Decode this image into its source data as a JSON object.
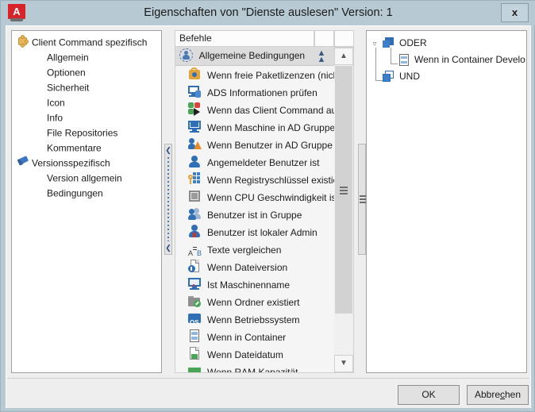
{
  "window": {
    "title": "Eigenschaften von \"Dienste auslesen\" Version: 1",
    "app_icon": "app-logo-a-icon",
    "app_icon_letter": "A",
    "close_label": "x"
  },
  "left_tree": {
    "items": [
      {
        "label": "Client Command spezifisch",
        "icon": "puzzle-icon",
        "indent": 0
      },
      {
        "label": "Allgemein",
        "icon": "none",
        "indent": 1
      },
      {
        "label": "Optionen",
        "icon": "none",
        "indent": 1
      },
      {
        "label": "Sicherheit",
        "icon": "none",
        "indent": 1
      },
      {
        "label": "Icon",
        "icon": "none",
        "indent": 1
      },
      {
        "label": "Info",
        "icon": "none",
        "indent": 1
      },
      {
        "label": "File Repositories",
        "icon": "none",
        "indent": 1
      },
      {
        "label": "Kommentare",
        "icon": "none",
        "indent": 1
      },
      {
        "label": "Versionsspezifisch",
        "icon": "pushpin-icon",
        "indent": 0
      },
      {
        "label": "Version allgemein",
        "icon": "none",
        "indent": 1
      },
      {
        "label": "Bedingungen",
        "icon": "none",
        "indent": 1
      }
    ]
  },
  "command_list": {
    "columns": [
      "Befehle",
      "",
      ""
    ],
    "group": {
      "label": "Allgemeine Bedingungen",
      "icon": "group-condition-icon",
      "collapse_icon": "chevron-double-up-icon"
    },
    "items": [
      {
        "label": "Wenn freie Paketlizenzen (nich...",
        "icon": "license-lock-icon"
      },
      {
        "label": "ADS Informationen prüfen",
        "icon": "ads-monitor-icon"
      },
      {
        "label": "Wenn das Client Command aus...",
        "icon": "command-run-icon"
      },
      {
        "label": "Wenn Maschine in AD Gruppe ist",
        "icon": "ad-machine-icon"
      },
      {
        "label": "Wenn Benutzer in AD Gruppe ist",
        "icon": "ad-user-icon"
      },
      {
        "label": "Angemeldeter Benutzer ist",
        "icon": "user-icon"
      },
      {
        "label": "Wenn Registryschlüssel existiert",
        "icon": "registry-key-icon"
      },
      {
        "label": "Wenn CPU Geschwindigkeit ist",
        "icon": "cpu-icon"
      },
      {
        "label": "Benutzer ist in Gruppe",
        "icon": "user-group-icon"
      },
      {
        "label": "Benutzer ist lokaler Admin",
        "icon": "user-admin-icon"
      },
      {
        "label": "Texte vergleichen",
        "icon": "text-compare-icon"
      },
      {
        "label": "Wenn Dateiversion",
        "icon": "file-version-icon"
      },
      {
        "label": "Ist Maschinenname",
        "icon": "machine-name-icon"
      },
      {
        "label": "Wenn Ordner existiert",
        "icon": "folder-check-icon"
      },
      {
        "label": "Wenn Betriebssystem",
        "icon": "os-icon"
      },
      {
        "label": "Wenn in Container",
        "icon": "container-icon"
      },
      {
        "label": "Wenn Dateidatum",
        "icon": "file-date-icon"
      },
      {
        "label": "Wenn RAM Kapazität",
        "icon": "ram-icon"
      }
    ],
    "scrollbar": {
      "up": "▲",
      "down": "▼"
    }
  },
  "condition_tree": {
    "items": [
      {
        "label": "ODER",
        "icon": "or-node-icon",
        "indent": 0,
        "expander": "expanded"
      },
      {
        "label": "Wenn in Container Develo...",
        "icon": "container-icon",
        "indent": 1,
        "expander": "none"
      },
      {
        "label": "UND",
        "icon": "and-node-icon",
        "indent": 0,
        "expander": "none"
      }
    ]
  },
  "buttons": {
    "ok": "OK",
    "cancel_prefix": "Abbre",
    "cancel_accel": "c",
    "cancel_suffix": "hen"
  }
}
